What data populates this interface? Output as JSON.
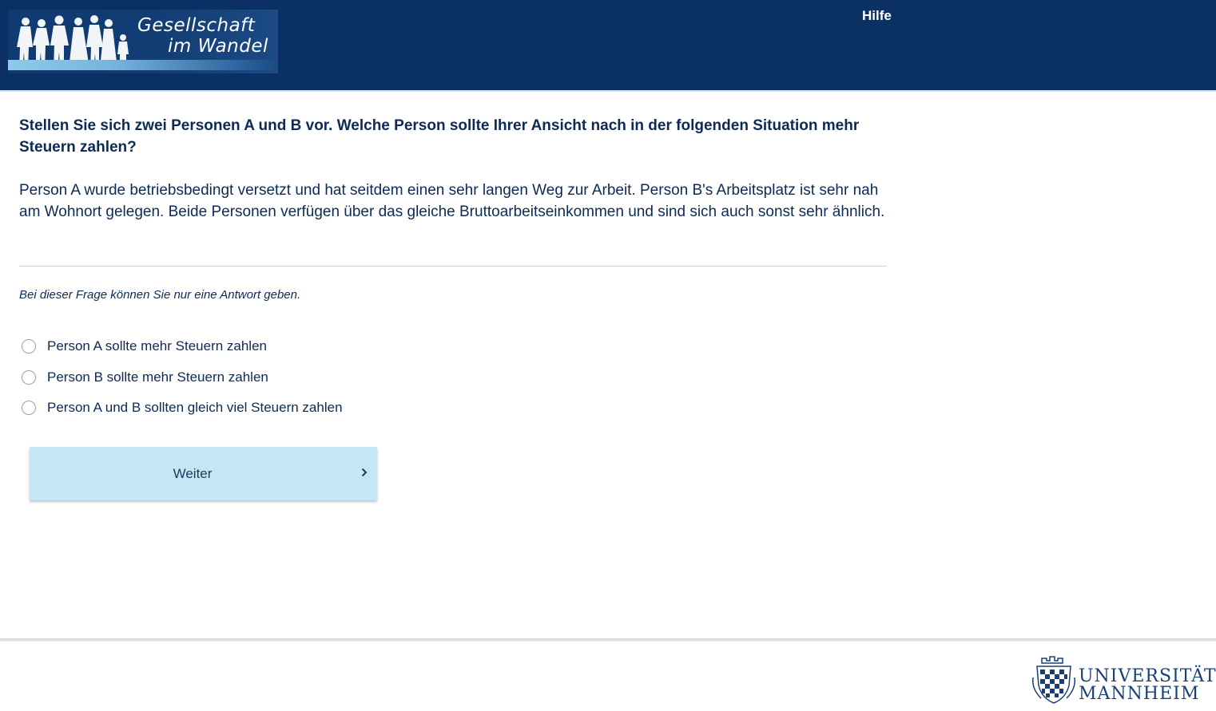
{
  "header": {
    "logo": {
      "line1": "Gesellschaft",
      "line2": "im Wandel"
    },
    "help_label": "Hilfe"
  },
  "survey": {
    "question": "Stellen Sie sich zwei Personen A und B vor. Welche Person sollte Ihrer Ansicht nach in der folgenden Situation mehr Steuern zahlen?",
    "situation": "Person A wurde betriebsbedingt versetzt und hat seitdem einen sehr langen Weg zur Arbeit. Person B's Arbeitsplatz ist sehr nah am Wohnort gelegen. Beide Personen verfügen über das gleiche Bruttoarbeitseinkommen und sind sich auch sonst sehr ähnlich.",
    "hint": "Bei dieser Frage können Sie nur eine Antwort geben.",
    "options": [
      {
        "label": "Person A sollte mehr Steuern zahlen",
        "selected": false
      },
      {
        "label": "Person B sollte mehr Steuern zahlen",
        "selected": false
      },
      {
        "label": "Person A und B sollten gleich viel Steuern zahlen",
        "selected": false
      }
    ],
    "next_label": "Weiter"
  },
  "footer": {
    "university_line1": "UNIVERSITÄT",
    "university_line2": "MANNHEIM"
  },
  "colors": {
    "header_bg": "#0b3064",
    "text": "#0d2a55",
    "button_bg": "#c5e7f5",
    "university_blue": "#1a3f78"
  }
}
